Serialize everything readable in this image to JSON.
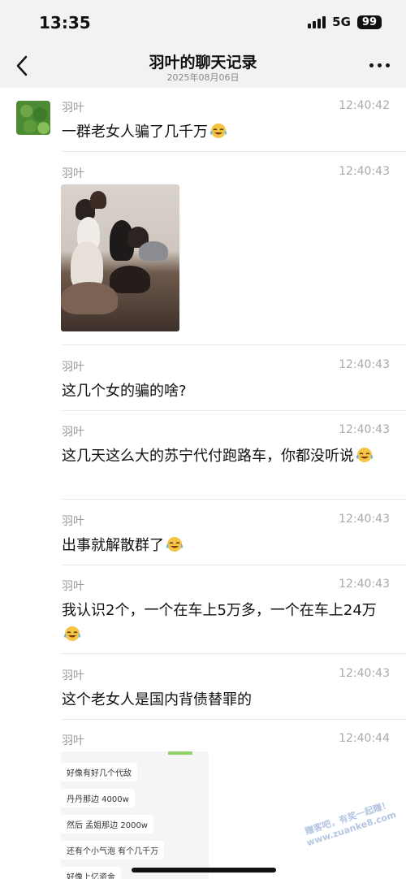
{
  "status_bar": {
    "time": "13:35",
    "network": "5G",
    "battery": "99"
  },
  "header": {
    "title": "羽叶的聊天记录",
    "date": "2025年08月06日"
  },
  "messages": [
    {
      "sender": "羽叶",
      "time": "12:40:42",
      "text": "一群老女人骗了几千万"
    },
    {
      "sender": "羽叶",
      "time": "12:40:43"
    },
    {
      "sender": "羽叶",
      "time": "12:40:43",
      "text": "这几个女的骗的啥?"
    },
    {
      "sender": "羽叶",
      "time": "12:40:43",
      "text": "这几天这么大的苏宁代付跑路车，你都没听说"
    },
    {
      "sender": "羽叶",
      "time": "12:40:43",
      "text": "出事就解散群了"
    },
    {
      "sender": "羽叶",
      "time": "12:40:43",
      "text": "我认识2个，一个在车上5万多，一个在车上24万"
    },
    {
      "sender": "羽叶",
      "time": "12:40:43",
      "text": "这个老女人是国内背债替罪的"
    },
    {
      "sender": "羽叶",
      "time": "12:40:44"
    }
  ],
  "screenshot_bubbles": [
    "好像有好几个代敌",
    "丹丹那边 4000w",
    "然后 孟姐那边 2000w",
    "还有个小气泡 有个几千万",
    "好像上亿资金"
  ],
  "watermark": {
    "line1": "赚客吧，有奖一起赚！",
    "line2": "www.zuanke8.com"
  },
  "icons": {
    "back": "back-chevron-icon",
    "more": "more-dots-icon",
    "emoji": "laughing-tears-emoji-icon"
  }
}
